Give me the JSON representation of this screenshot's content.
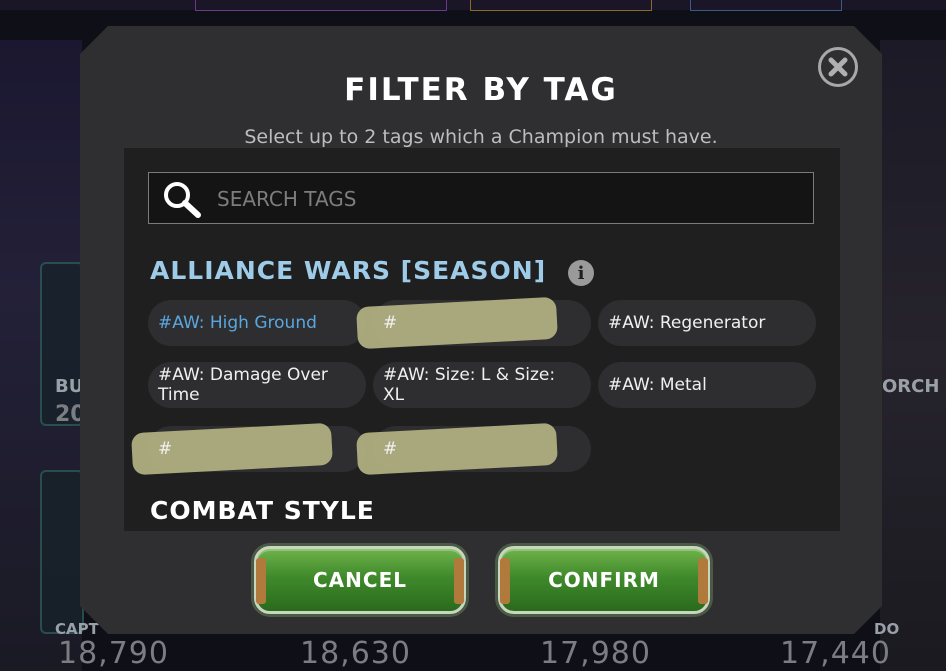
{
  "dialog": {
    "title": "FILTER BY TAG",
    "subtitle": "Select up to 2 tags which a Champion must have.",
    "close_icon": "close-x-circle"
  },
  "search": {
    "placeholder": "SEARCH TAGS",
    "value": ""
  },
  "sections": {
    "alliance_wars": {
      "title": "ALLIANCE WARS [SEASON]",
      "tags": [
        {
          "label": "#AW: High Ground",
          "selected": true
        },
        {
          "label": "#",
          "redacted": true
        },
        {
          "label": "#AW: Regenerator"
        },
        {
          "label": "#AW: Damage Over Time"
        },
        {
          "label": "#AW: Size: L & Size: XL"
        },
        {
          "label": "#AW: Metal"
        },
        {
          "label": "#",
          "redacted": true
        },
        {
          "label": "#",
          "redacted": true
        }
      ]
    },
    "combat_style": {
      "title": "COMBAT STYLE"
    }
  },
  "buttons": {
    "cancel": "CANCEL",
    "confirm": "CONFIRM"
  },
  "background": {
    "left_name": "BU",
    "left_value": "20",
    "right_name": "ORCH",
    "bottom_left_name": "CAPT",
    "stats": [
      "18,790",
      "18,630",
      "17,980",
      "17,440"
    ],
    "right_bottom_name": "DO"
  },
  "colors": {
    "modal_bg": "#2f2f31",
    "content_bg": "#1f1f20",
    "section_accent": "#9ecbe8",
    "selected_tag": "#5aa7df",
    "button_green": "#3f8a2b"
  }
}
